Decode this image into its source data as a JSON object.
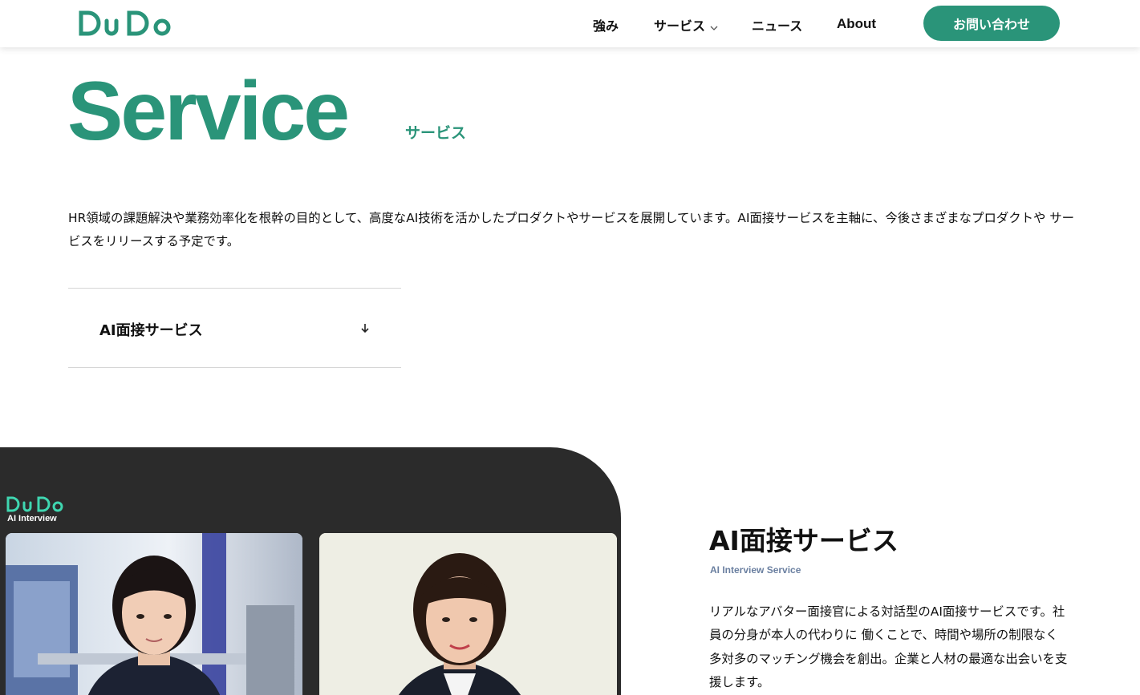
{
  "header": {
    "logo_icon": "dudo-logo",
    "nav": {
      "strength": "強み",
      "service": "サービス",
      "news": "ニュース",
      "about": "About"
    },
    "contact": "お問い合わせ"
  },
  "hero": {
    "title": "Service",
    "subtitle": "サービス",
    "intro": "HR領域の課題解決や業務効率化を根幹の目的として、高度なAI技術を活かしたプロダクトやサービスを展開しています。AI面接サービスを主軸に、今後さまざまなプロダクトや サービスをリリースする予定です。"
  },
  "accordion": {
    "item_label": "AI面接サービス",
    "arrow_icon": "arrow-down-icon"
  },
  "product": {
    "panel_logo_caption": "AI Interview",
    "heading": "AI面接サービス",
    "en_label": "AI Interview Service",
    "description": "リアルなアバター面接官による対話型のAI面接サービスです。社員の分身が本人の代わりに 働くことで、時間や場所の制限なく多対多のマッチング機会を創出。企業と人材の最適な出会いを支援します。"
  },
  "colors": {
    "brand": "#2a9479",
    "panel_bg": "#2b2b2b",
    "en_label": "#6a7fa0"
  }
}
